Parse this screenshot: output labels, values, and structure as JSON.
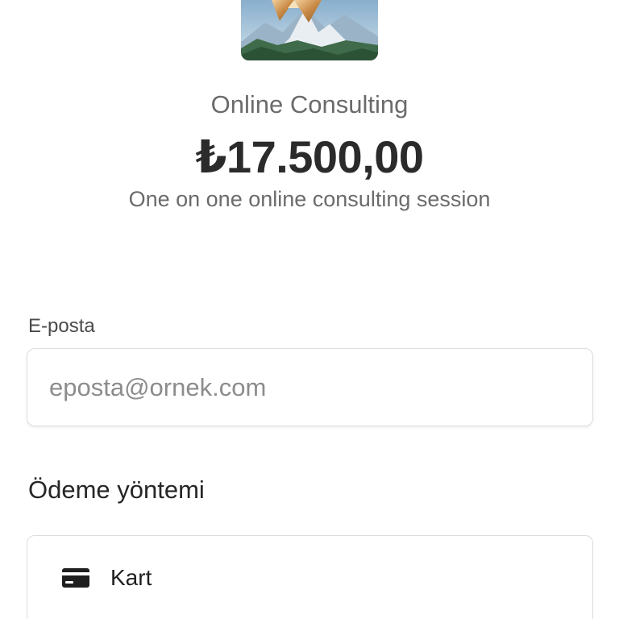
{
  "product": {
    "name": "Online Consulting",
    "price": "₺17.500,00",
    "description": "One on one online consulting session"
  },
  "email": {
    "label": "E-posta",
    "placeholder": "eposta@ornek.com",
    "value": ""
  },
  "payment": {
    "title": "Ödeme yöntemi",
    "options": [
      {
        "label": "Kart",
        "icon": "credit-card-icon"
      }
    ]
  }
}
